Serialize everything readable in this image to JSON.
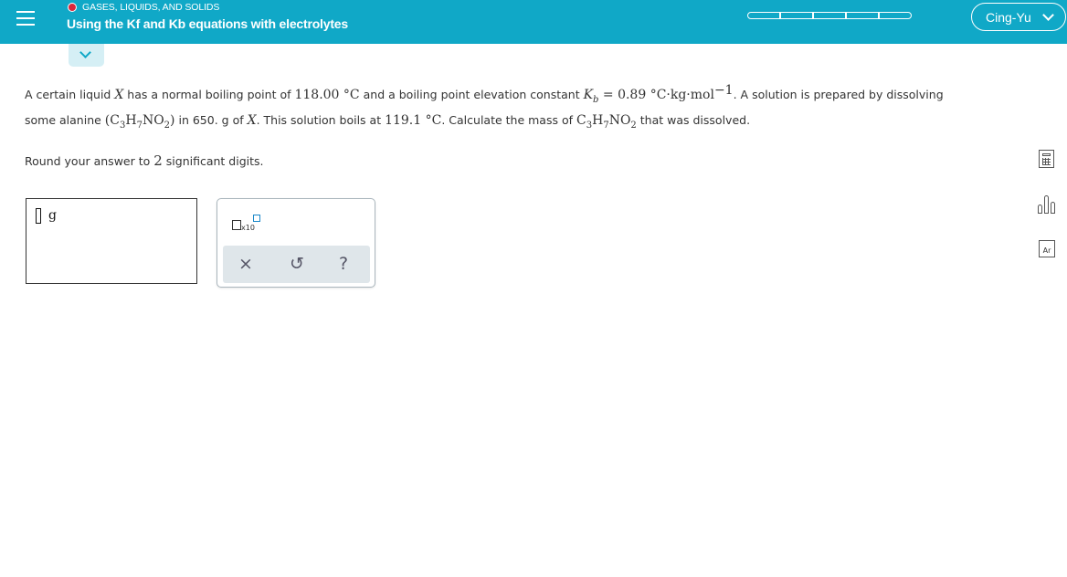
{
  "header": {
    "topic": "GASES, LIQUIDS, AND SOLIDS",
    "title": "Using the Kf and Kb equations with electrolytes",
    "progress_segments": 5,
    "user_name": "Cing-Yu",
    "bar_color": "#10a8c7",
    "status_dot_color": "#d9263a"
  },
  "problem": {
    "p1": "A certain liquid ",
    "var": "X",
    "p2": " has a normal boiling point of ",
    "bp": "118.00",
    "deg_c": " °C",
    "p3": " and a boiling point elevation constant ",
    "k": "K",
    "k_sub": "b",
    "eq": " = 0.89",
    "units": " °C·kg·mol",
    "units_exp": "−1",
    "p4": ". A solution is prepared by dissolving",
    "p5": "some alanine ",
    "lp": "(C",
    "s3": "3",
    "h": "H",
    "s7": "7",
    "no": "NO",
    "s2": "2",
    "rp": ")",
    "p6": " in ",
    "mass": "650. g",
    "p7": " of ",
    "p8": ". This solution boils at ",
    "boils": "119.1",
    "p9": ". Calculate the mass of ",
    "p10": " that was dissolved.",
    "round_a": "Round your answer to ",
    "round_n": "2",
    "round_b": " significant digits."
  },
  "answer": {
    "unit": "g"
  },
  "tools": {
    "x10_label": "x10",
    "clear_icon": "×",
    "undo_icon": "↺",
    "help_icon": "?"
  }
}
